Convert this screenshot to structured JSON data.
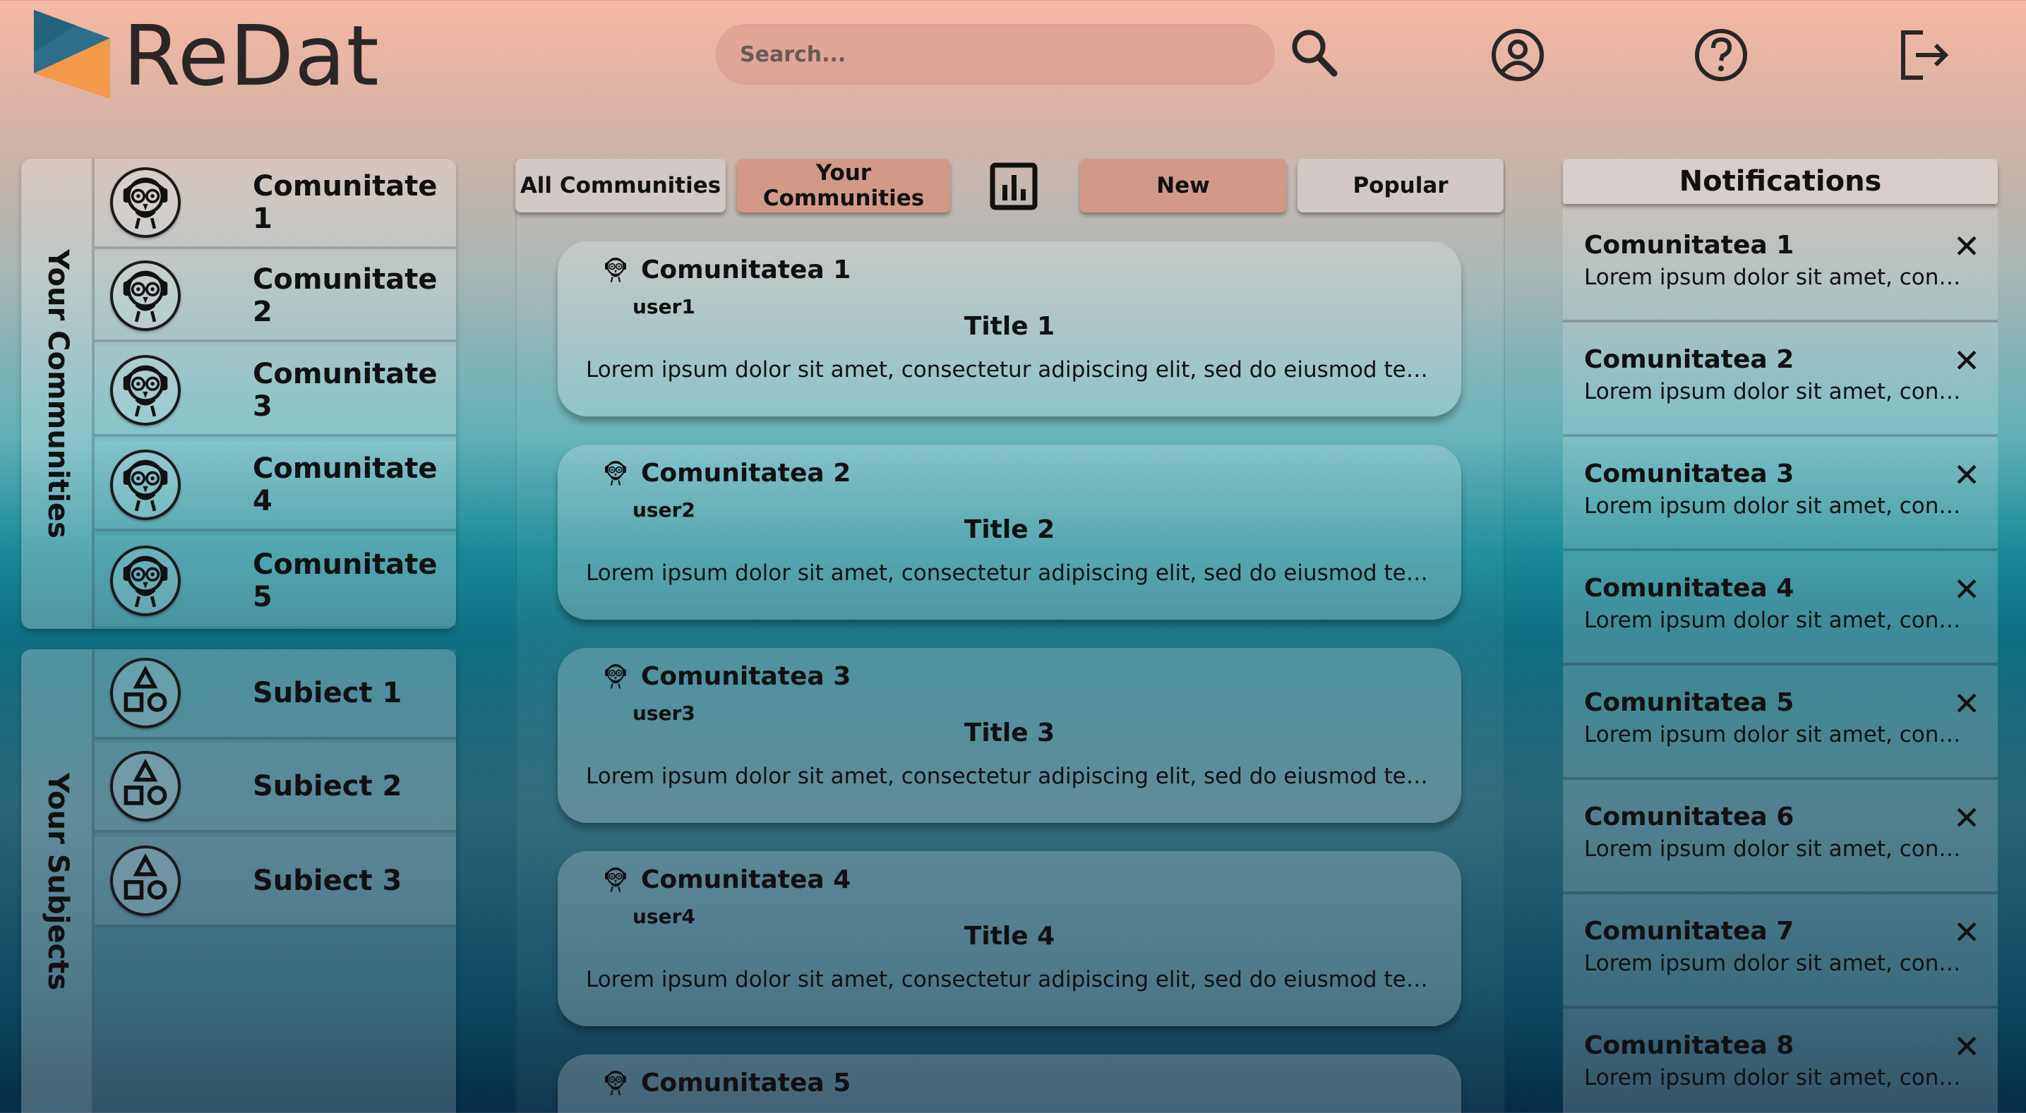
{
  "app": {
    "name": "ReDat"
  },
  "search": {
    "placeholder": "Search..."
  },
  "header_icons": [
    "search-icon",
    "user-profile-icon",
    "help-icon",
    "logout-icon"
  ],
  "sidebar": {
    "communities_label": "Your Communities",
    "communities": [
      {
        "label": "Comunitate 1"
      },
      {
        "label": "Comunitate 2"
      },
      {
        "label": "Comunitate 3"
      },
      {
        "label": "Comunitate 4"
      },
      {
        "label": "Comunitate 5"
      }
    ],
    "subjects_label": "Your Subjects",
    "subjects": [
      {
        "label": "Subiect 1"
      },
      {
        "label": "Subiect 2"
      },
      {
        "label": "Subiect 3"
      }
    ]
  },
  "feed_tabs": {
    "all": "All Communities",
    "yours": "Your Communities",
    "chart_icon": "bar-chart-icon",
    "new": "New",
    "popular": "Popular"
  },
  "posts": [
    {
      "community": "Comunitatea 1",
      "user": "user1",
      "title": "Title 1",
      "body": "Lorem ipsum dolor sit amet, consectetur adipiscing elit, sed do eiusmod tempor in..."
    },
    {
      "community": "Comunitatea 2",
      "user": "user2",
      "title": "Title 2",
      "body": "Lorem ipsum dolor sit amet, consectetur adipiscing elit, sed do eiusmod tempor in..."
    },
    {
      "community": "Comunitatea 3",
      "user": "user3",
      "title": "Title 3",
      "body": "Lorem ipsum dolor sit amet, consectetur adipiscing elit, sed do eiusmod tempor in..."
    },
    {
      "community": "Comunitatea 4",
      "user": "user4",
      "title": "Title 4",
      "body": "Lorem ipsum dolor sit amet, consectetur adipiscing elit, sed do eiusmod tempor in..."
    },
    {
      "community": "Comunitatea 5"
    }
  ],
  "notifications": {
    "title": "Notifications",
    "close_glyph": "✕",
    "items": [
      {
        "title": "Comunitatea 1",
        "body": "Lorem ipsum dolor sit amet, conse..."
      },
      {
        "title": "Comunitatea 2",
        "body": "Lorem ipsum dolor sit amet, conse..."
      },
      {
        "title": "Comunitatea 3",
        "body": "Lorem ipsum dolor sit amet, conse..."
      },
      {
        "title": "Comunitatea 4",
        "body": "Lorem ipsum dolor sit amet, conse..."
      },
      {
        "title": "Comunitatea 5",
        "body": "Lorem ipsum dolor sit amet, conse..."
      },
      {
        "title": "Comunitatea 6",
        "body": "Lorem ipsum dolor sit amet, conse..."
      },
      {
        "title": "Comunitatea 7",
        "body": "Lorem ipsum dolor sit amet, conse..."
      },
      {
        "title": "Comunitatea 8",
        "body": "Lorem ipsum dolor sit amet, conse..."
      }
    ]
  },
  "colors": {
    "active_tab": "#d29a86",
    "logo_blue": "#2d6f8a",
    "logo_orange": "#f2994a"
  }
}
